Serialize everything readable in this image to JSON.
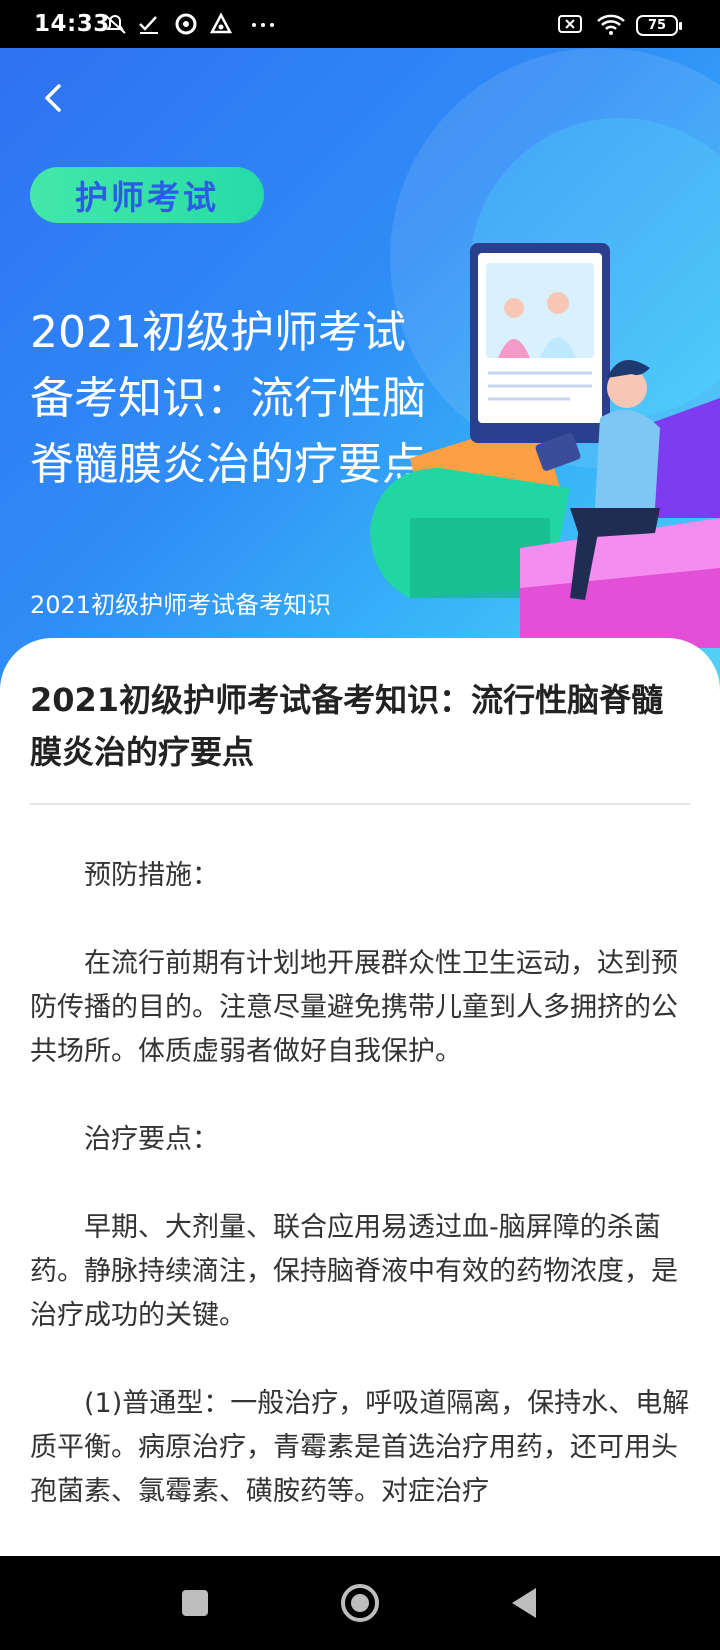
{
  "status_bar": {
    "time": "14:33",
    "icons": [
      "muted-notification-icon",
      "check-icon",
      "aperture-icon",
      "triangle-app-icon",
      "more-dots-icon",
      "sim-off-icon",
      "wifi-icon"
    ],
    "battery": "75"
  },
  "hero": {
    "tag": "护师考试",
    "title": "2021初级护师考试备考知识：流行性脑脊髓膜炎治的疗要点",
    "subtitle": "2021初级护师考试备考知识",
    "colors": {
      "gradient_start": "#2f71f2",
      "gradient_end": "#56d2f7",
      "tag_bg": "#2ee0a8",
      "tag_text": "#2d5be8"
    }
  },
  "article": {
    "title": "2021初级护师考试备考知识：流行性脑脊髓膜炎治的疗要点",
    "paragraphs": [
      "预防措施：",
      "在流行前期有计划地开展群众性卫生运动，达到预防传播的目的。注意尽量避免携带儿童到人多拥挤的公共场所。体质虚弱者做好自我保护。",
      "治疗要点：",
      "早期、大剂量、联合应用易透过血-脑屏障的杀菌药。静脉持续滴注，保持脑脊液中有效的药物浓度，是治疗成功的关键。",
      "(1)普通型：一般治疗，呼吸道隔离，保持水、电解质平衡。病原治疗，青霉素是首选治疗用药，还可用头孢菌素、氯霉素、磺胺药等。对症治疗"
    ]
  },
  "nav_bar": {
    "buttons": [
      "recents-square-icon",
      "home-circle-icon",
      "back-triangle-icon"
    ]
  }
}
